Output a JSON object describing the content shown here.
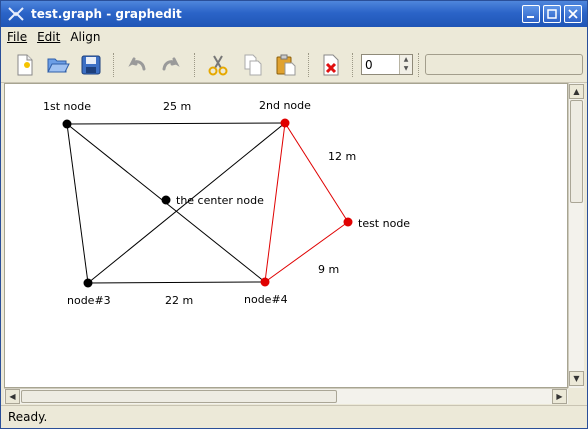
{
  "window": {
    "title": "test.graph - graphedit"
  },
  "menubar": {
    "items": [
      {
        "label": "File"
      },
      {
        "label": "Edit"
      },
      {
        "label": "Align"
      }
    ]
  },
  "toolbar": {
    "buttons": [
      "new-document-icon",
      "open-folder-icon",
      "save-icon",
      "undo-icon",
      "redo-icon",
      "cut-icon",
      "copy-icon",
      "paste-icon",
      "delete-icon"
    ],
    "spin_value": "0",
    "text_field_value": ""
  },
  "graph": {
    "nodes": [
      {
        "id": "1st",
        "label": "1st node",
        "color": "#000000"
      },
      {
        "id": "2nd",
        "label": "2nd node",
        "color": "#e00000"
      },
      {
        "id": "center",
        "label": "the center node",
        "color": "#000000"
      },
      {
        "id": "test",
        "label": "test node",
        "color": "#e00000"
      },
      {
        "id": "n3",
        "label": "node#3",
        "color": "#000000"
      },
      {
        "id": "n4",
        "label": "node#4",
        "color": "#e00000"
      }
    ],
    "edges": [
      {
        "from": "1st",
        "to": "2nd",
        "label": "25 m",
        "color": "#000000"
      },
      {
        "from": "1st",
        "to": "n3",
        "label": "",
        "color": "#000000"
      },
      {
        "from": "1st",
        "to": "n4",
        "label": "",
        "color": "#000000"
      },
      {
        "from": "2nd",
        "to": "n3",
        "label": "",
        "color": "#000000"
      },
      {
        "from": "n3",
        "to": "n4",
        "label": "22 m",
        "color": "#000000"
      },
      {
        "from": "2nd",
        "to": "test",
        "label": "12 m",
        "color": "#e00000"
      },
      {
        "from": "2nd",
        "to": "n4",
        "label": "",
        "color": "#e00000"
      },
      {
        "from": "test",
        "to": "n4",
        "label": "9 m",
        "color": "#e00000"
      }
    ]
  },
  "status": {
    "text": "Ready."
  },
  "colors": {
    "selected": "#e00000",
    "normal": "#000000",
    "titlebar": "#2b64c8"
  }
}
